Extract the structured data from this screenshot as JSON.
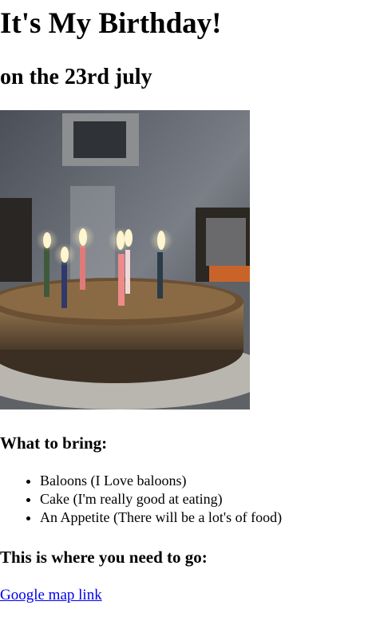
{
  "header": {
    "title": "It's My Birthday!",
    "subtitle": "on the 23rd july"
  },
  "photo": {
    "icon": "birthday-cake-with-candles-image",
    "colors": {
      "background": "#3a3d42",
      "cake": "#8a6a42",
      "frosting": "#5b4128",
      "flame": "#fff6d0"
    }
  },
  "bring": {
    "heading": "What to bring:",
    "items": [
      "Baloons (I Love baloons)",
      "Cake (I'm really good at eating)",
      "An Appetite (There will be a lot's of food)"
    ]
  },
  "directions": {
    "heading": "This is where you need to go:",
    "link_text": "Google map link",
    "link_color": "#0000ee"
  }
}
